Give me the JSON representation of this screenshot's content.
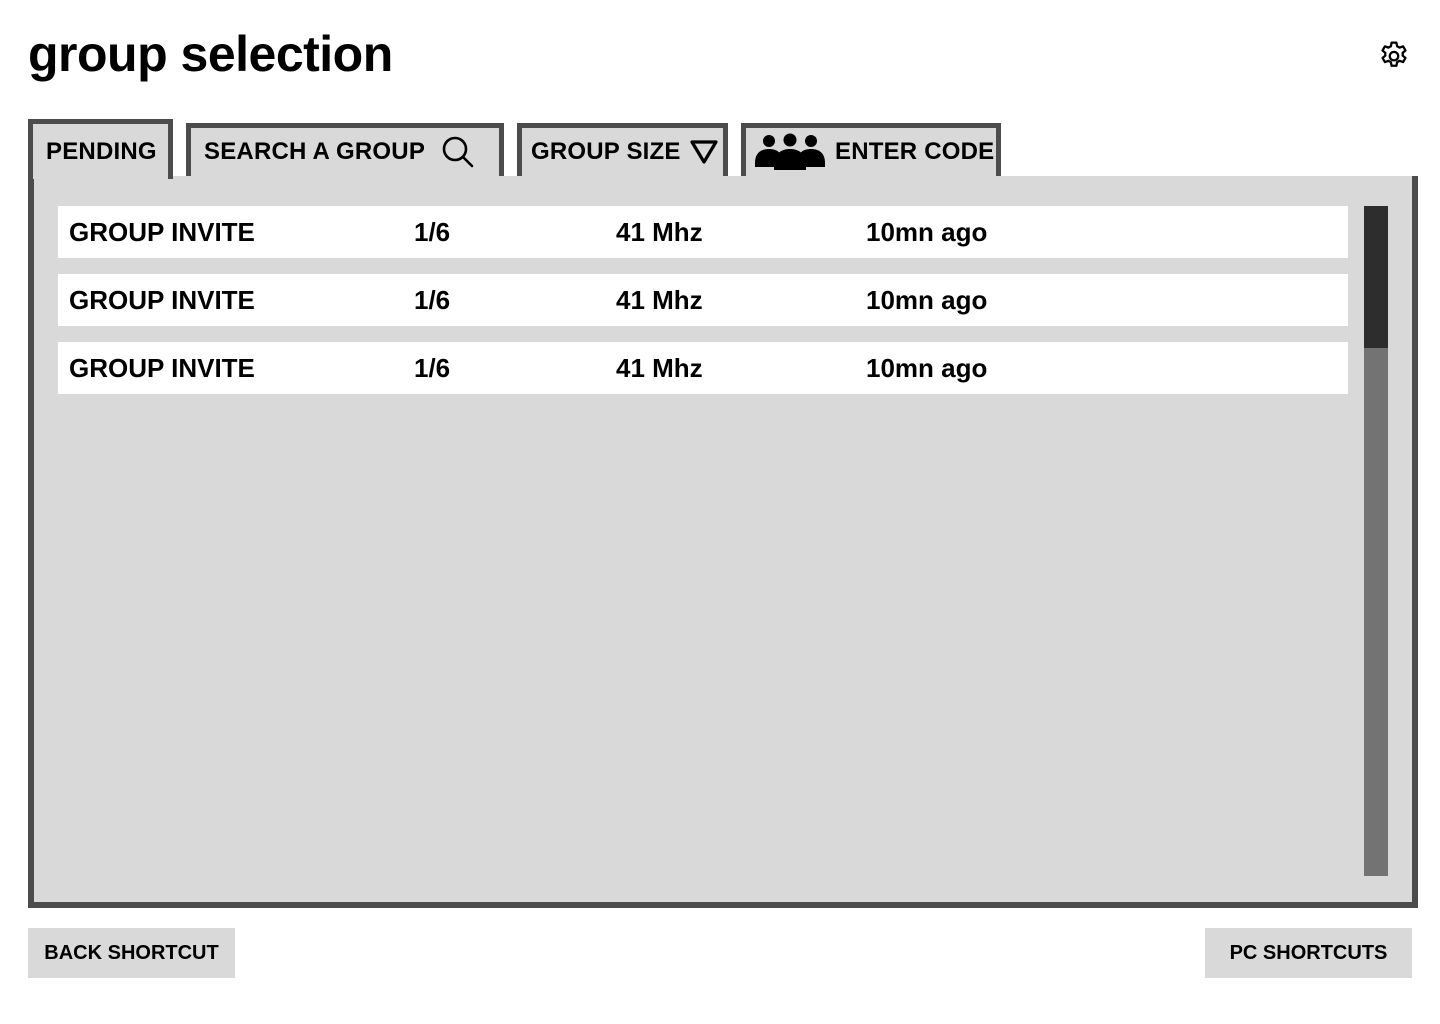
{
  "header": {
    "title": "group selection",
    "settings_icon": "gear-icon"
  },
  "tabs": [
    {
      "label": "PENDING",
      "active": true
    },
    {
      "label": "SEARCH A GROUP",
      "icon": "search-icon"
    },
    {
      "label": "GROUP SIZE",
      "icon": "triangle-down-icon"
    },
    {
      "label": "ENTER CODE",
      "icon": "group-people-icon"
    }
  ],
  "list": {
    "rows": [
      {
        "name": "GROUP INVITE",
        "size": "1/6",
        "frequency": "41 Mhz",
        "time": "10mn ago"
      },
      {
        "name": "GROUP INVITE",
        "size": "1/6",
        "frequency": "41 Mhz",
        "time": "10mn ago"
      },
      {
        "name": "GROUP INVITE",
        "size": "1/6",
        "frequency": "41 Mhz",
        "time": "10mn ago"
      }
    ]
  },
  "footer": {
    "back_label": "BACK SHORTCUT",
    "pc_label": "PC SHORTCUTS"
  },
  "colors": {
    "border": "#4c4c4c",
    "panel": "#d9d9d9",
    "scroll_track": "#737373",
    "scroll_thumb": "#2d2d2d"
  }
}
